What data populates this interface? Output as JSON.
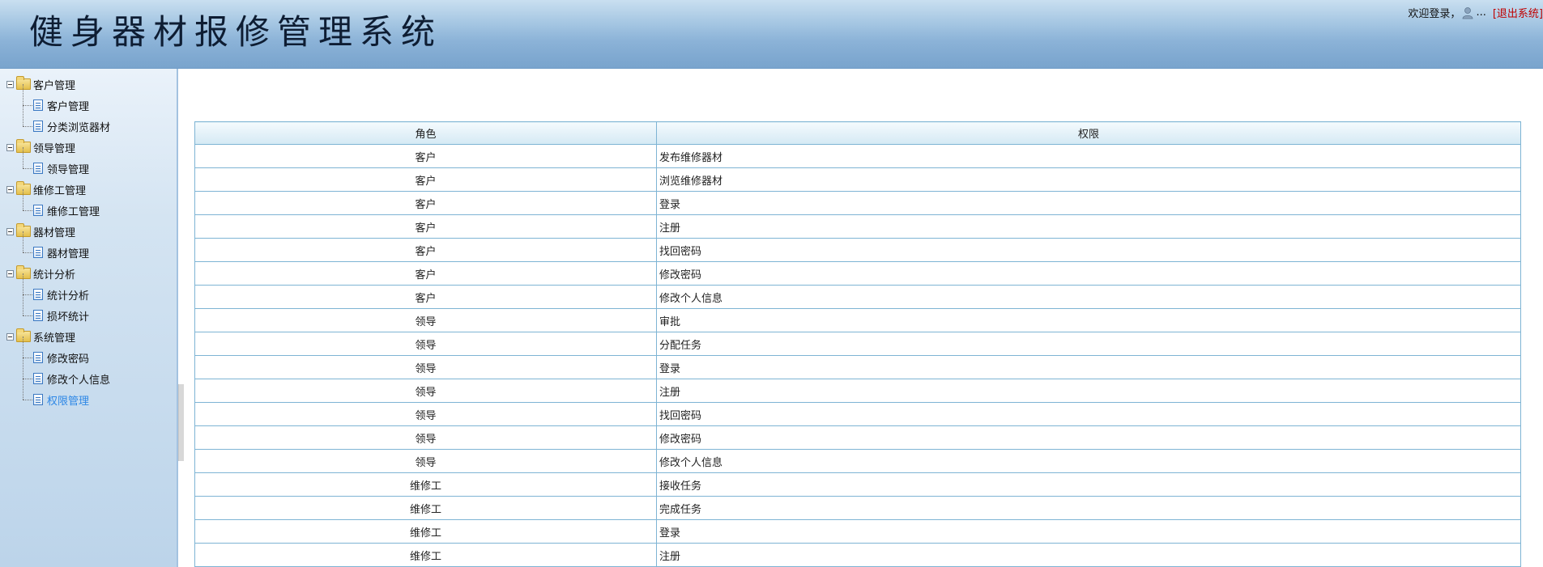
{
  "header": {
    "title": "健身器材报修管理系统",
    "welcome": "欢迎登录，",
    "user": "...",
    "logout": "[退出系统]"
  },
  "sidebar": {
    "groups": [
      {
        "label": "客户管理",
        "items": [
          "客户管理",
          "分类浏览器材"
        ]
      },
      {
        "label": "领导管理",
        "items": [
          "领导管理"
        ]
      },
      {
        "label": "维修工管理",
        "items": [
          "维修工管理"
        ]
      },
      {
        "label": "器材管理",
        "items": [
          "器材管理"
        ]
      },
      {
        "label": "统计分析",
        "items": [
          "统计分析",
          "损坏统计"
        ]
      },
      {
        "label": "系统管理",
        "items": [
          "修改密码",
          "修改个人信息",
          "权限管理"
        ]
      }
    ],
    "active": "权限管理"
  },
  "table": {
    "headers": [
      "角色",
      "权限"
    ],
    "rows": [
      [
        "客户",
        "发布维修器材"
      ],
      [
        "客户",
        "浏览维修器材"
      ],
      [
        "客户",
        "登录"
      ],
      [
        "客户",
        "注册"
      ],
      [
        "客户",
        "找回密码"
      ],
      [
        "客户",
        "修改密码"
      ],
      [
        "客户",
        "修改个人信息"
      ],
      [
        "领导",
        "审批"
      ],
      [
        "领导",
        "分配任务"
      ],
      [
        "领导",
        "登录"
      ],
      [
        "领导",
        "注册"
      ],
      [
        "领导",
        "找回密码"
      ],
      [
        "领导",
        "修改密码"
      ],
      [
        "领导",
        "修改个人信息"
      ],
      [
        "维修工",
        "接收任务"
      ],
      [
        "维修工",
        "完成任务"
      ],
      [
        "维修工",
        "登录"
      ],
      [
        "维修工",
        "注册"
      ]
    ]
  },
  "colors": {
    "accent_link": "#2f88e6",
    "logout": "#c00000",
    "table_border": "#7eb4d4"
  },
  "icons": [
    "user-icon",
    "folder-icon",
    "page-icon",
    "expander-icon"
  ]
}
